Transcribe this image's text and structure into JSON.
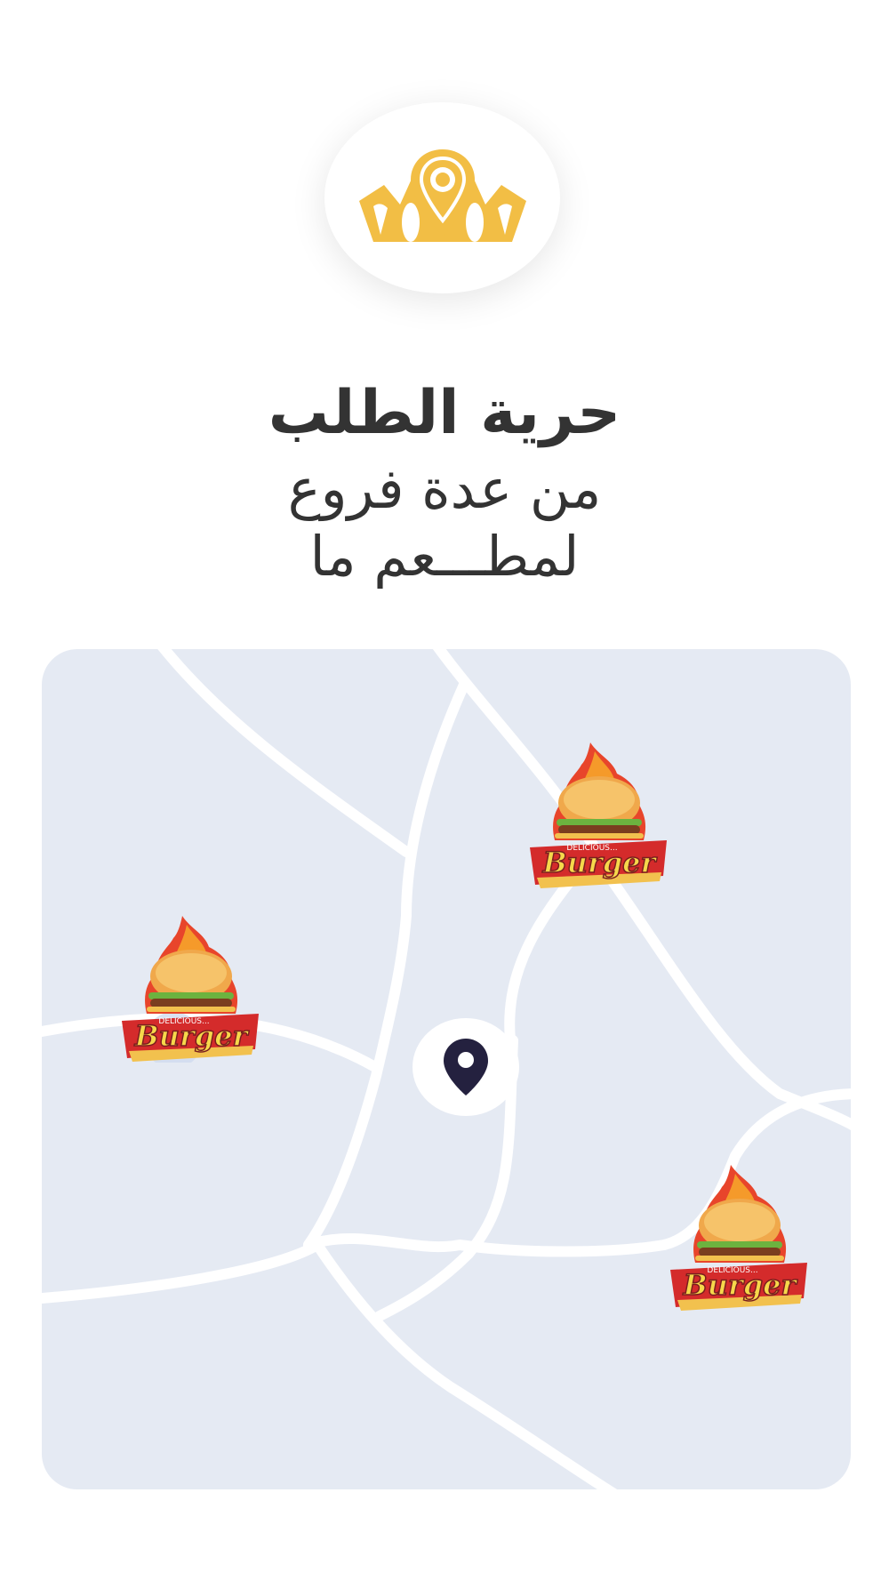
{
  "colors": {
    "brand_gold": "#F2BE45",
    "map_background": "#E5EAF3",
    "road": "#FFFFFF",
    "pin": "#24213F",
    "text": "#333333"
  },
  "logo": {
    "icon": "crown-pin-icon"
  },
  "headline": {
    "title": "حرية الطلب",
    "line2": "من عدة فروع",
    "line3": "لمطـــعم ما"
  },
  "map": {
    "center_pin_icon": "location-pin-icon",
    "restaurant_markers": [
      {
        "icon": "burger-logo-icon",
        "top_text": "DELICIOUS...",
        "brand": "Burger"
      },
      {
        "icon": "burger-logo-icon",
        "top_text": "DELICIOUS...",
        "brand": "Burger"
      },
      {
        "icon": "burger-logo-icon",
        "top_text": "DELICIOUS...",
        "brand": "Burger"
      }
    ]
  }
}
